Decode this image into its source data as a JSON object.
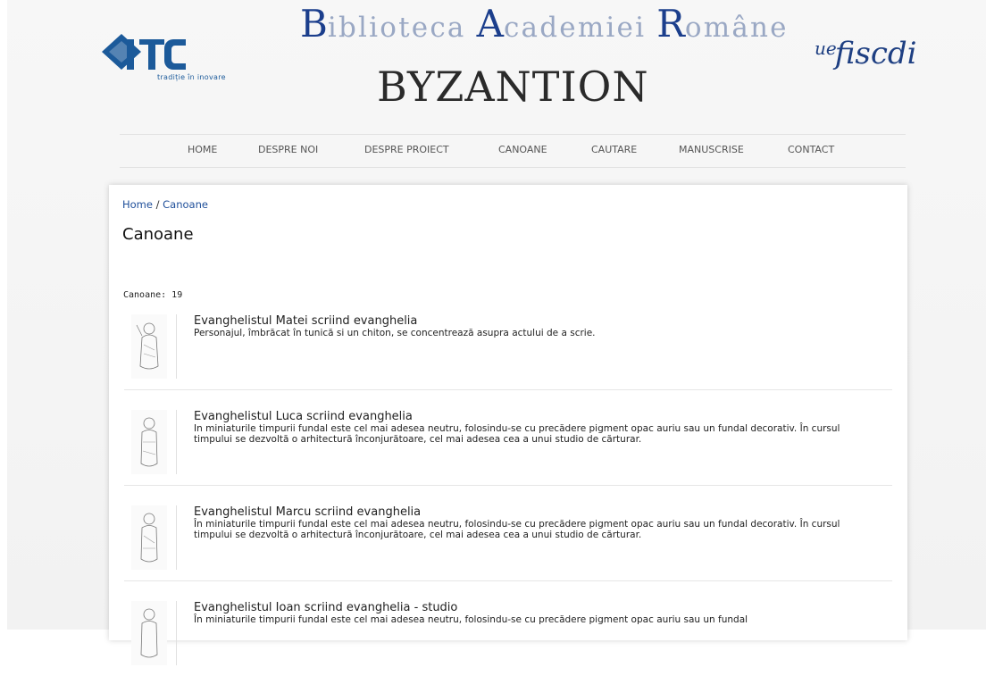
{
  "header": {
    "itc_logo_text": "ITC",
    "itc_tagline": "tradiție în inovare",
    "library_title_parts": [
      {
        "cap": "B",
        "rest": "iblioteca "
      },
      {
        "cap": "A",
        "rest": "cademiei "
      },
      {
        "cap": "R",
        "rest": "omâne"
      }
    ],
    "site_title": "BYZANTION",
    "partner_logo_ue": "ue",
    "partner_logo_main": "fiscdi"
  },
  "nav": {
    "items": [
      "HOME",
      "DESPRE NOI",
      "DESPRE PROIECT",
      "CANOANE",
      "CAUTARE",
      "MANUSCRISE",
      "CONTACT"
    ]
  },
  "breadcrumb": {
    "home": "Home",
    "separator": " / ",
    "current": "Canoane"
  },
  "page_title": "Canoane",
  "count_label": "Canoane: 19",
  "items": [
    {
      "title": "Evanghelistul Matei scriind evanghelia",
      "description": "Personajul, îmbrăcat în tunică si un chiton, se concentrează asupra actului de a scrie."
    },
    {
      "title": "Evanghelistul Luca scriind evanghelia",
      "description": "In miniaturile timpurii fundal este cel mai adesea neutru, folosindu-se cu precădere pigment opac auriu sau un fundal decorativ. În cursul timpului se dezvoltă o arhitectură înconjurătoare, cel mai adesea cea a unui studio de cărturar."
    },
    {
      "title": "Evanghelistul Marcu scriind evanghelia",
      "description": "În miniaturile timpurii fundal este cel mai adesea neutru, folosindu-se cu precădere pigment opac auriu sau un fundal decorativ. În cursul timpului se dezvoltă o arhitectură înconjurătoare, cel mai adesea cea a unui studio de cărturar."
    },
    {
      "title": "Evanghelistul Ioan scriind evanghelia - studio",
      "description": "În miniaturile timpurii fundal este cel mai adesea neutru, folosindu-se cu precădere pigment opac auriu sau un fundal"
    }
  ],
  "colors": {
    "brand_blue": "#1b3e8c",
    "link_blue": "#1f4f9a",
    "nav_text": "#555555"
  }
}
